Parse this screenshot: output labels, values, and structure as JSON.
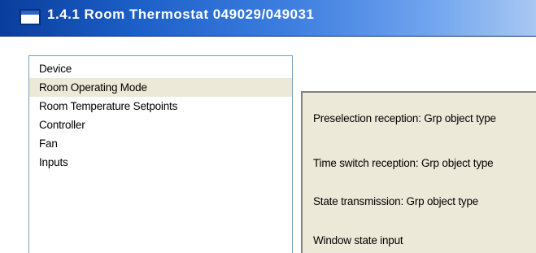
{
  "window": {
    "title": "1.4.1 Room Thermostat 049029/049031"
  },
  "tree": {
    "items": [
      {
        "label": "Device",
        "selected": false
      },
      {
        "label": "Room Operating Mode",
        "selected": true
      },
      {
        "label": "Room Temperature Setpoints",
        "selected": false
      },
      {
        "label": "Controller",
        "selected": false
      },
      {
        "label": "Fan",
        "selected": false
      },
      {
        "label": "Inputs",
        "selected": false
      }
    ]
  },
  "parameters": [
    {
      "label": "Preselection reception: Grp object type"
    },
    {
      "label": "Time switch reception: Grp object type"
    },
    {
      "label": "State transmission: Grp object type"
    },
    {
      "label": "Window state input"
    }
  ]
}
